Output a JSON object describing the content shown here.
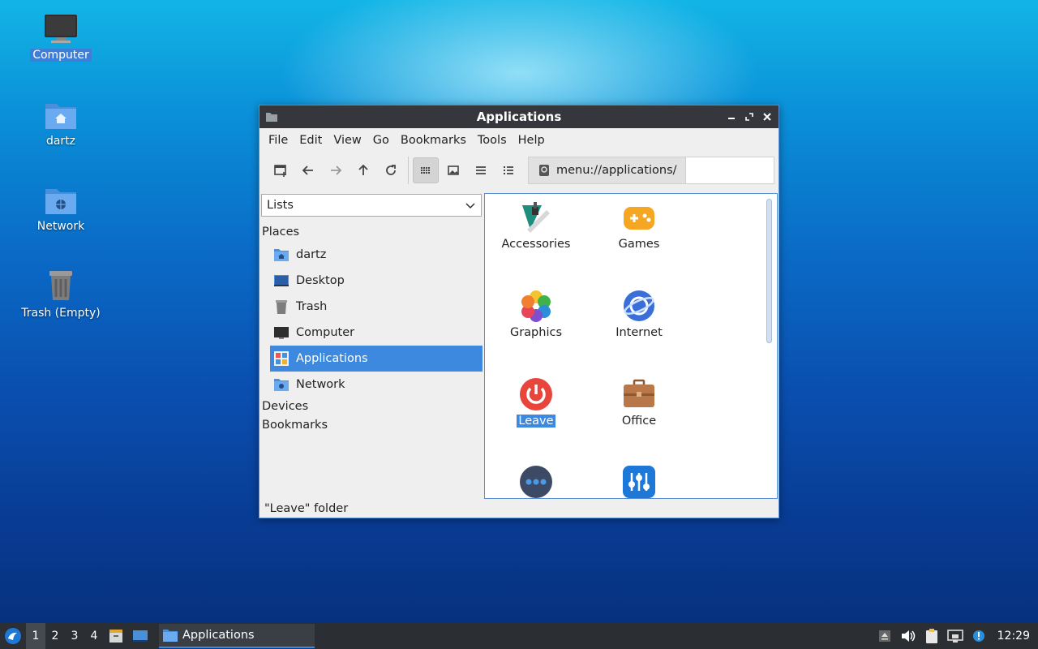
{
  "desktop": {
    "icons": [
      {
        "label": "Computer",
        "selected": true
      },
      {
        "label": "dartz"
      },
      {
        "label": "Network"
      },
      {
        "label": "Trash (Empty)"
      }
    ]
  },
  "window": {
    "title": "Applications",
    "menu": [
      "File",
      "Edit",
      "View",
      "Go",
      "Bookmarks",
      "Tools",
      "Help"
    ],
    "address": "menu://applications/",
    "sidebar": {
      "combo": "Lists",
      "places_header": "Places",
      "places": [
        {
          "label": "dartz",
          "icon": "home-folder-icon"
        },
        {
          "label": "Desktop",
          "icon": "desktop-icon"
        },
        {
          "label": "Trash",
          "icon": "trash-icon"
        },
        {
          "label": "Computer",
          "icon": "computer-icon"
        },
        {
          "label": "Applications",
          "icon": "applications-icon",
          "selected": true
        },
        {
          "label": "Network",
          "icon": "network-folder-icon"
        }
      ],
      "devices_header": "Devices",
      "bookmarks_header": "Bookmarks"
    },
    "items": [
      {
        "label": "Accessories",
        "icon": "accessories-icon"
      },
      {
        "label": "Games",
        "icon": "games-icon"
      },
      {
        "label": "Graphics",
        "icon": "graphics-icon"
      },
      {
        "label": "Internet",
        "icon": "internet-icon"
      },
      {
        "label": "Leave",
        "icon": "power-icon",
        "selected": true
      },
      {
        "label": "Office",
        "icon": "office-icon"
      }
    ],
    "status": "\"Leave\" folder"
  },
  "taskbar": {
    "workspaces": [
      "1",
      "2",
      "3",
      "4"
    ],
    "task_label": "Applications",
    "clock": "12:29"
  },
  "colors": {
    "accent": "#3d89e0",
    "titlebar": "#35373c",
    "taskbar": "#2b2e33"
  }
}
